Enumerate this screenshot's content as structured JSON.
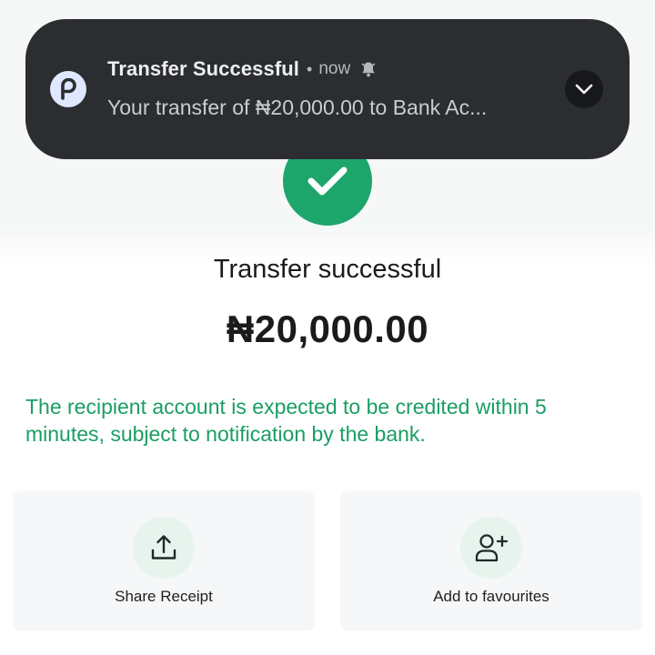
{
  "notification": {
    "title": "Transfer Successful",
    "separator": "•",
    "time": "now",
    "body": "Your transfer of ₦20,000.00 to Bank Ac...",
    "app_icon_letter": "p",
    "icons": {
      "app": "app-logo-icon",
      "bell": "bell-muted-icon",
      "expand": "chevron-down-icon"
    }
  },
  "result": {
    "icon": "checkmark-icon",
    "title": "Transfer successful",
    "amount": "₦20,000.00",
    "notice": "The recipient account is expected to be credited within 5 minutes, subject to notification by the bank."
  },
  "actions": [
    {
      "label": "Share Receipt",
      "icon": "share-upload-icon"
    },
    {
      "label": "Add to favourites",
      "icon": "add-user-icon"
    }
  ],
  "colors": {
    "accent_green": "#1da56b",
    "notice_green": "#1a9e63",
    "notification_bg": "#2b2d31"
  }
}
